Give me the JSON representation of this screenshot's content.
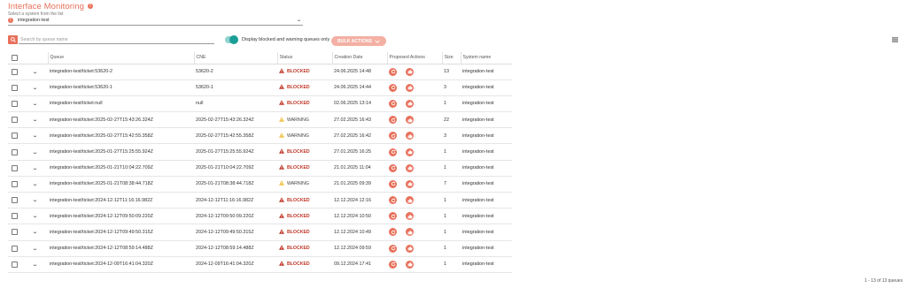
{
  "header": {
    "title": "Interface Monitoring",
    "info_icon": "info-icon",
    "subtitle": "Select a system from the list"
  },
  "system_select": {
    "value": "integration-test",
    "icon": "system-dot-icon"
  },
  "toolbar": {
    "search_placeholder": "Search by queue name",
    "search_value": "",
    "toggle_label": "Display blocked and warning queues only",
    "toggle_on": true,
    "bulk_actions_label": "BULK ACTIONS"
  },
  "colors": {
    "accent": "#e8705a",
    "toggle": "#1a9e97",
    "blocked": "#c0392b",
    "warning": "#f0c040"
  },
  "table": {
    "headers": {
      "queue": "Queue",
      "cne": "CNE",
      "status": "Status",
      "creation_date": "Creation Date",
      "proposed_actions": "Proposed Actions",
      "size": "Size",
      "system_name": "System name"
    },
    "rows": [
      {
        "queue": "integration-test/ticket:53620-2",
        "cne": "53620-2",
        "status": "BLOCKED",
        "date": "24.06.2025 14:48",
        "size": "13",
        "system": "integration-test"
      },
      {
        "queue": "integration-test/ticket:53620-1",
        "cne": "53620-1",
        "status": "BLOCKED",
        "date": "24.06.2025 14:44",
        "size": "3",
        "system": "integration-test"
      },
      {
        "queue": "integration-test/ticket:null",
        "cne": "null",
        "status": "BLOCKED",
        "date": "02.06.2025 13:14",
        "size": "1",
        "system": "integration-test"
      },
      {
        "queue": "integration-test/ticket:2025-02-27T15:43:26.324Z",
        "cne": "2025-02-27T15:43:26.324Z",
        "status": "WARNING",
        "date": "27.02.2025 16:43",
        "size": "22",
        "system": "integration-test"
      },
      {
        "queue": "integration-test/ticket:2025-02-27T15:42:55.358Z",
        "cne": "2025-02-27T15:42:55.358Z",
        "status": "WARNING",
        "date": "27.02.2025 16:42",
        "size": "3",
        "system": "integration-test"
      },
      {
        "queue": "integration-test/ticket:2025-01-27T15:25:55.924Z",
        "cne": "2025-01-27T15:25:55.924Z",
        "status": "BLOCKED",
        "date": "27.01.2025 16:25",
        "size": "1",
        "system": "integration-test"
      },
      {
        "queue": "integration-test/ticket:2025-01-21T10:04:22.709Z",
        "cne": "2025-01-21T10:04:22.709Z",
        "status": "BLOCKED",
        "date": "21.01.2025 11:04",
        "size": "1",
        "system": "integration-test"
      },
      {
        "queue": "integration-test/ticket:2025-01-21T08:38:44.718Z",
        "cne": "2025-01-21T08:38:44.718Z",
        "status": "WARNING",
        "date": "21.01.2025 09:39",
        "size": "7",
        "system": "integration-test"
      },
      {
        "queue": "integration-test/ticket:2024-12-12T11:16:16.982Z",
        "cne": "2024-12-12T11:16:16.982Z",
        "status": "BLOCKED",
        "date": "12.12.2024 12:16",
        "size": "1",
        "system": "integration-test"
      },
      {
        "queue": "integration-test/ticket:2024-12-12T09:50:09.220Z",
        "cne": "2024-12-12T09:50:09.220Z",
        "status": "BLOCKED",
        "date": "12.12.2024 10:50",
        "size": "1",
        "system": "integration-test"
      },
      {
        "queue": "integration-test/ticket:2024-12-12T09:49:50.315Z",
        "cne": "2024-12-12T09:49:50.315Z",
        "status": "BLOCKED",
        "date": "12.12.2024 10:49",
        "size": "1",
        "system": "integration-test"
      },
      {
        "queue": "integration-test/ticket:2024-12-12T08:59:14.488Z",
        "cne": "2024-12-12T08:59:14.488Z",
        "status": "BLOCKED",
        "date": "12.12.2024 09:59",
        "size": "1",
        "system": "integration-test"
      },
      {
        "queue": "integration-test/ticket:2024-12-09T16:41:04.320Z",
        "cne": "2024-12-09T16:41:04.320Z",
        "status": "BLOCKED",
        "date": "09.12.2024 17:41",
        "size": "1",
        "system": "integration-test"
      }
    ]
  },
  "footer": {
    "pagination": "1 - 13 of 13 queues"
  }
}
